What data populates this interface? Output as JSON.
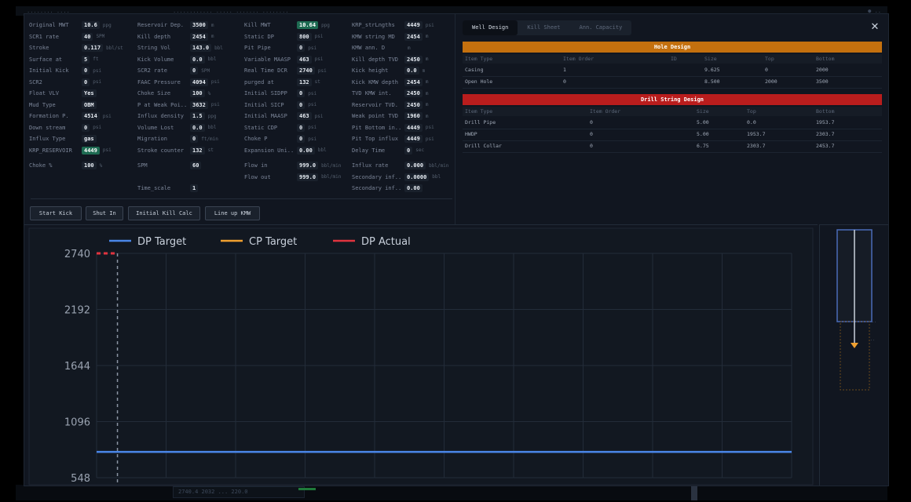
{
  "background": {
    "title_text": "........ ....",
    "center_text": "............ ..... ....... ........",
    "corner_text": "● ..",
    "bottom_text": "2740.4    2032 ...    220.0"
  },
  "params": [
    {
      "label": "Original MWT",
      "value": "10.6",
      "unit": "ppg"
    },
    {
      "label": "Reservoir Dep.",
      "value": "3500",
      "unit": "m"
    },
    {
      "label": "Kill MWT",
      "value": "10.64",
      "unit": "ppg",
      "hl": true
    },
    {
      "label": "KRP_strLngths",
      "value": "4449",
      "unit": "psi"
    },
    {
      "label": "SCR1 rate",
      "value": "40",
      "unit": "SPM"
    },
    {
      "label": "Kill depth",
      "value": "2454",
      "unit": "m"
    },
    {
      "label": "Static DP",
      "value": "800",
      "unit": "psi"
    },
    {
      "label": "KMW string MD",
      "value": "2454",
      "unit": "m"
    },
    {
      "label": "Stroke",
      "value": "0.117",
      "unit": "bbl/st"
    },
    {
      "label": "String Vol",
      "value": "143.0",
      "unit": "bbl"
    },
    {
      "label": "Pit Pipe",
      "value": "0",
      "unit": "psi"
    },
    {
      "label": "KMW ann. D",
      "value": "",
      "unit": "m"
    },
    {
      "label": "Surface at",
      "value": "5",
      "unit": "ft"
    },
    {
      "label": "Kick Volume",
      "value": "0.0",
      "unit": "bbl"
    },
    {
      "label": "Variable MAASP",
      "value": "463",
      "unit": "psi"
    },
    {
      "label": "Kill depth TVD",
      "value": "2450",
      "unit": "m"
    },
    {
      "label": "Initial Kick",
      "value": "0",
      "unit": "psi"
    },
    {
      "label": "SCR2 rate",
      "value": "0",
      "unit": "SPM"
    },
    {
      "label": "Real Time DCR",
      "value": "2740",
      "unit": "psi"
    },
    {
      "label": "Kick height",
      "value": "0.0",
      "unit": "m"
    },
    {
      "label": "SCR2",
      "value": "0",
      "unit": "psi"
    },
    {
      "label": "FAAC Pressure",
      "value": "4094",
      "unit": "psi"
    },
    {
      "label": "purged at",
      "value": "132",
      "unit": "st"
    },
    {
      "label": "Kick KMW depth",
      "value": "2454",
      "unit": "m"
    },
    {
      "label": "Float VLV",
      "value": "Yes",
      "unit": ""
    },
    {
      "label": "Choke Size",
      "value": "100",
      "unit": "%"
    },
    {
      "label": "Initial SIDPP",
      "value": "0",
      "unit": "psi"
    },
    {
      "label": "TVD KMW int.",
      "value": "2450",
      "unit": "m"
    },
    {
      "label": "Mud Type",
      "value": "OBM",
      "unit": ""
    },
    {
      "label": "P at Weak Poi..",
      "value": "3632",
      "unit": "psi"
    },
    {
      "label": "Initial SICP",
      "value": "0",
      "unit": "psi"
    },
    {
      "label": "Reservoir TVD.",
      "value": "2450",
      "unit": "m"
    },
    {
      "label": "Formation P.",
      "value": "4514",
      "unit": "psi"
    },
    {
      "label": "Influx density",
      "value": "1.5",
      "unit": "ppg"
    },
    {
      "label": "Initial MAASP",
      "value": "463",
      "unit": "psi"
    },
    {
      "label": "Weak point TVD",
      "value": "1960",
      "unit": "m"
    },
    {
      "label": "Down stream",
      "value": "0",
      "unit": "psi"
    },
    {
      "label": "Volume Lost",
      "value": "0.0",
      "unit": "bbl"
    },
    {
      "label": "Static CDP",
      "value": "0",
      "unit": "psi"
    },
    {
      "label": "Pit Bottom in..",
      "value": "4449",
      "unit": "psi"
    },
    {
      "label": "Influx Type",
      "value": "gas",
      "unit": ""
    },
    {
      "label": "Migration",
      "value": "0",
      "unit": "ft/min"
    },
    {
      "label": "Choke P",
      "value": "0",
      "unit": "psi"
    },
    {
      "label": "Pit Top influx",
      "value": "4449",
      "unit": "psi"
    },
    {
      "label": "KRP_RESERVOIR",
      "value": "4449",
      "unit": "psi",
      "hl": true
    },
    {
      "label": "Stroke counter",
      "value": "132",
      "unit": "st"
    },
    {
      "label": "Expansion Uni..",
      "value": "0.00",
      "unit": "bbl"
    },
    {
      "label": "Delay Time",
      "value": "0",
      "unit": "sec"
    },
    {
      "label": "Choke %",
      "value": "100",
      "unit": "%"
    },
    {
      "label": "SPM",
      "value": "60",
      "unit": ""
    },
    {
      "label": "Flow in",
      "value": "999.0",
      "unit": "bbl/min"
    },
    {
      "label": "Influx rate",
      "value": "0.000",
      "unit": "bbl/min"
    },
    {
      "label": "Flow out",
      "value": "999.0",
      "unit": "bbl/min"
    },
    {
      "label": "Secondary inf..",
      "value": "0.0000",
      "unit": "bbl"
    },
    {
      "label": "Time_scale",
      "value": "1",
      "unit": ""
    },
    {
      "label": "Secondary inf..",
      "value": "0.00",
      "unit": ""
    }
  ],
  "buttons": [
    {
      "id": "start-kick",
      "label": "Start Kick"
    },
    {
      "id": "shut-in",
      "label": "Shut In"
    },
    {
      "id": "initial-kill-calc",
      "label": "Initial Kill Calc"
    },
    {
      "id": "line-up-kmw",
      "label": "Line up KMW"
    }
  ],
  "tabs": [
    {
      "label": "Well Design",
      "active": true
    },
    {
      "label": "Kill Sheet",
      "active": false
    },
    {
      "label": "Ann. Capacity",
      "active": false
    }
  ],
  "hole_design": {
    "title": "Hole Design",
    "color": "#c4700e",
    "headers": [
      "Item Type",
      "Item Order",
      "ID",
      "Size",
      "Top",
      "Bottom"
    ],
    "rows": [
      [
        "Casing",
        "1",
        "",
        "9.625",
        "0",
        "2000"
      ],
      [
        "Open Hole",
        "0",
        "",
        "8.500",
        "2000",
        "3500"
      ]
    ]
  },
  "drill_string": {
    "title": "Drill String Design",
    "color": "#b91d1d",
    "headers": [
      "Item Type",
      "Item Order",
      "Size",
      "Top",
      "Bottom"
    ],
    "rows": [
      [
        "Drill Pipe",
        "0",
        "5.00",
        "0.0",
        "1953.7"
      ],
      [
        "HWDP",
        "0",
        "5.00",
        "1953.7",
        "2303.7"
      ],
      [
        "Drill Collar",
        "0",
        "6.75",
        "2303.7",
        "2453.7"
      ]
    ]
  },
  "chart_data": {
    "type": "line",
    "legend": [
      "DP Target",
      "CP Target",
      "DP Actual"
    ],
    "colors": {
      "DP Target": "#4a86e8",
      "CP Target": "#f0a030",
      "DP Actual": "#e0343f"
    },
    "y_ticks": [
      2740,
      2192,
      1644,
      1096,
      548
    ],
    "ylim": [
      548,
      2740
    ],
    "xlim": [
      0,
      100
    ],
    "series": [
      {
        "name": "DP Target",
        "x": [
          0,
          100
        ],
        "y": [
          800,
          800
        ],
        "style": "solid"
      },
      {
        "name": "DP Actual",
        "x": [
          0,
          3
        ],
        "y": [
          2740,
          2740
        ],
        "style": "dashed"
      }
    ],
    "marker_x": 3,
    "grid": true
  },
  "well_schematic": {
    "hole_color": "#4a6bb8",
    "string_color": "#c9d1dc",
    "arrow_color": "#f0a030",
    "labels": [
      "..",
      ".."
    ]
  }
}
